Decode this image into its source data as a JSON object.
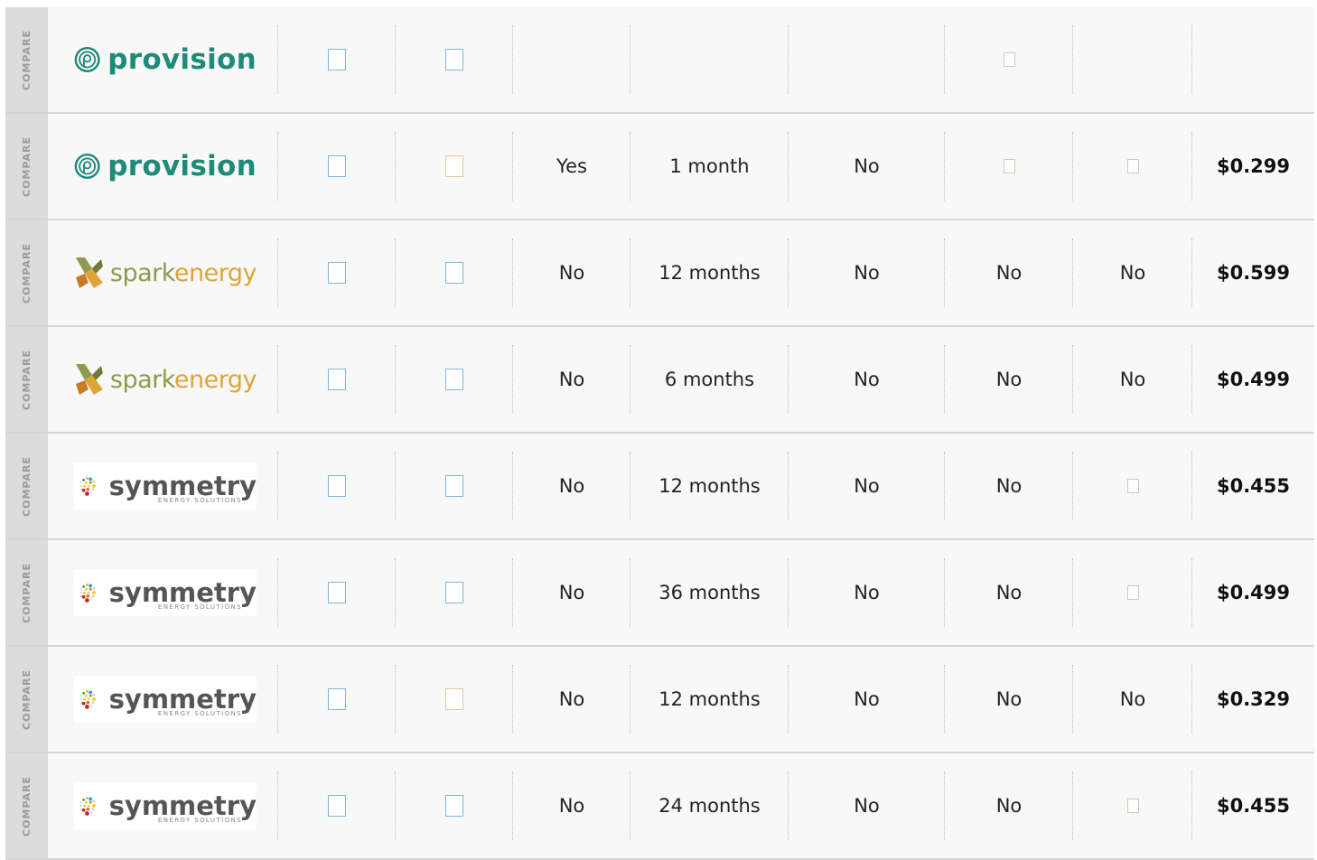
{
  "compare_label": "COMPARE",
  "rows": [
    {
      "brand": "provision",
      "brand_text": "provision",
      "c1": "blue",
      "c2": "blue",
      "promo": "",
      "term": "",
      "fee": "",
      "c6": "green",
      "c7": "none",
      "price": ""
    },
    {
      "brand": "provision",
      "brand_text": "provision",
      "c1": "blue",
      "c2": "tan",
      "promo": "Yes",
      "term": "1 month",
      "fee": "No",
      "c6": "green",
      "c7": "green",
      "price": "$0.299"
    },
    {
      "brand": "spark",
      "brand_text_a": "spark",
      "brand_text_b": "energy",
      "c1": "blue",
      "c2": "blue",
      "promo": "No",
      "term": "12 months",
      "fee": "No",
      "c6": "No",
      "c7": "No",
      "price": "$0.599"
    },
    {
      "brand": "spark",
      "brand_text_a": "spark",
      "brand_text_b": "energy",
      "c1": "blue",
      "c2": "blue",
      "promo": "No",
      "term": "6 months",
      "fee": "No",
      "c6": "No",
      "c7": "No",
      "price": "$0.499"
    },
    {
      "brand": "symmetry",
      "brand_text": "symmetry",
      "brand_sub": "ENERGY SOLUTIONS",
      "c1": "blue",
      "c2": "blue",
      "promo": "No",
      "term": "12 months",
      "fee": "No",
      "c6": "No",
      "c7": "green",
      "price": "$0.455"
    },
    {
      "brand": "symmetry",
      "brand_text": "symmetry",
      "brand_sub": "ENERGY SOLUTIONS",
      "c1": "blue",
      "c2": "blue",
      "promo": "No",
      "term": "36 months",
      "fee": "No",
      "c6": "No",
      "c7": "green",
      "price": "$0.499"
    },
    {
      "brand": "symmetry",
      "brand_text": "symmetry",
      "brand_sub": "ENERGY SOLUTIONS",
      "c1": "blue",
      "c2": "tan",
      "promo": "No",
      "term": "12 months",
      "fee": "No",
      "c6": "No",
      "c7": "No",
      "price": "$0.329"
    },
    {
      "brand": "symmetry",
      "brand_text": "symmetry",
      "brand_sub": "ENERGY SOLUTIONS",
      "c1": "blue",
      "c2": "blue",
      "promo": "No",
      "term": "24 months",
      "fee": "No",
      "c6": "No",
      "c7": "green",
      "price": "$0.455"
    }
  ],
  "colors": {
    "provision": "#1e8a78",
    "spark_a": "#8f9a4a",
    "spark_b": "#e0a33a",
    "checkbox_blue": "#7fb6dc",
    "checkbox_tan": "#e2c79a",
    "checkbox_green": "#b7d9a7"
  }
}
